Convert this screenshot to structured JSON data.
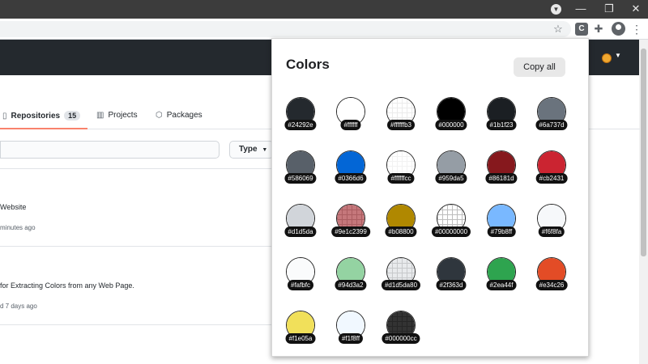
{
  "browser": {
    "window_buttons": [
      "—",
      "❐",
      "✕"
    ],
    "icons": [
      "star-icon",
      "extension-c-icon",
      "puzzle-icon",
      "account-icon",
      "menu-dots-icon"
    ],
    "ext_letter": "C"
  },
  "github": {
    "tabs": [
      {
        "label": "Repositories",
        "count": "15",
        "icon": "repo-icon",
        "active": true
      },
      {
        "label": "Projects",
        "icon": "project-icon",
        "active": false
      },
      {
        "label": "Packages",
        "icon": "package-icon",
        "active": false
      }
    ],
    "type_button": "Type",
    "repos": [
      {
        "description": "Website",
        "updated": "minutes ago"
      },
      {
        "description": "for Extracting Colors from any Web Page.",
        "updated": "d 7 days ago"
      }
    ]
  },
  "popup": {
    "title": "Colors",
    "copy_all": "Copy all",
    "colors": [
      "#24292e",
      "#ffffff",
      "#ffffffb3",
      "#000000",
      "#1b1f23",
      "#6a737d",
      "#586069",
      "#0366d6",
      "#ffffffcc",
      "#959da5",
      "#86181d",
      "#cb2431",
      "#d1d5da",
      "#9e1c2399",
      "#b08800",
      "#00000000",
      "#79b8ff",
      "#f6f8fa",
      "#fafbfc",
      "#94d3a2",
      "#d1d5da80",
      "#2f363d",
      "#2ea44f",
      "#e34c26",
      "#f1e05a",
      "#f1f8ff",
      "#000000cc"
    ]
  }
}
